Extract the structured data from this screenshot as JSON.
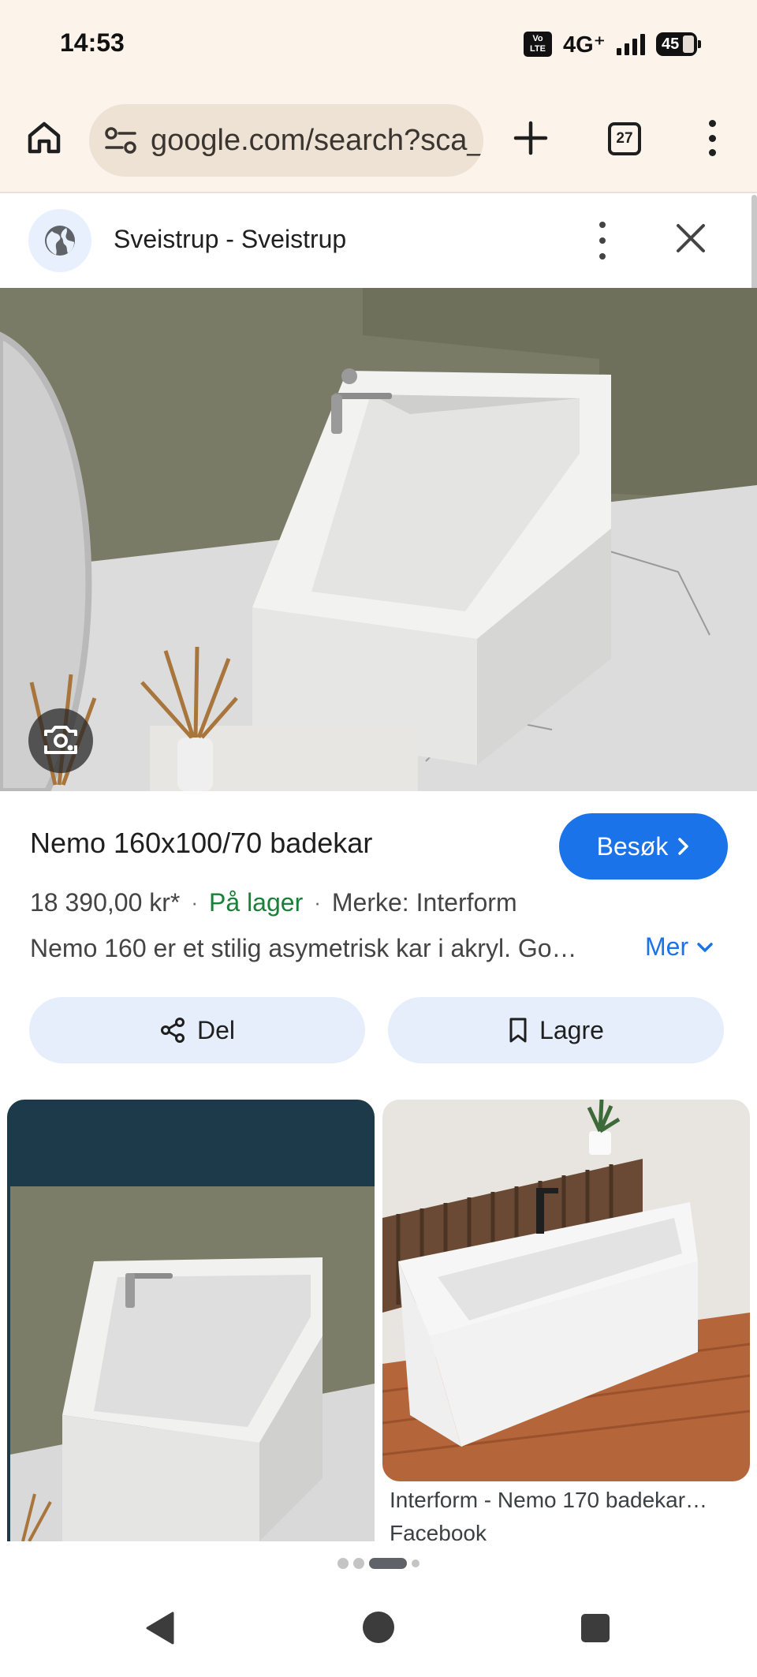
{
  "status_bar": {
    "time": "14:53",
    "volte": "Vo LTE",
    "network": "4G⁺",
    "battery": "45"
  },
  "toolbar": {
    "url": "google.com/search?sca_",
    "tab_count": "27"
  },
  "source": {
    "name": "Sveistrup - Sveistrup"
  },
  "product": {
    "title": "Nemo 160x100/70 badekar",
    "visit_label": "Besøk",
    "price": "18 390,00 kr*",
    "separator": "·",
    "stock": "På lager",
    "brand": "Merke: Interform",
    "description": "Nemo 160 er et stilig asymetrisk kar i akryl. God…",
    "more_label": "Mer"
  },
  "actions": {
    "share_label": "Del",
    "save_label": "Lagre"
  },
  "related": [
    {
      "title": "",
      "source": ""
    },
    {
      "title": "Interform - Nemo 170 badekar…",
      "source": "Facebook"
    }
  ],
  "pager": {
    "count": 4,
    "active": 2
  },
  "colors": {
    "chrome_bg": "#fcf3eb",
    "url_pill": "#ede2d3",
    "accent_blue": "#1a73e8",
    "stock_green": "#188038",
    "action_btn_bg": "#e6eefc"
  },
  "icons": [
    "home-icon",
    "tune-icon",
    "plus-icon",
    "tabs-icon",
    "overflow-menu-icon",
    "globe-icon",
    "close-icon",
    "lens-icon",
    "chevron-right-icon",
    "chevron-down-icon",
    "share-icon",
    "bookmark-icon",
    "back-icon"
  ]
}
